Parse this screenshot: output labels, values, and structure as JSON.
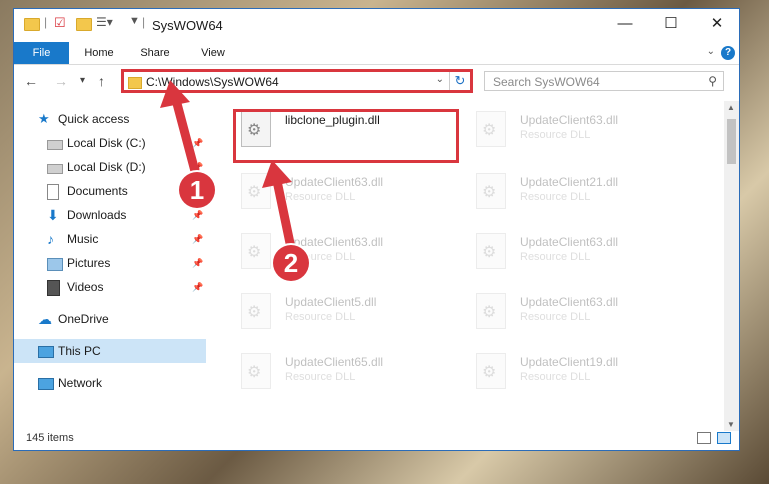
{
  "window": {
    "title": "SysWOW64",
    "minimize": "—",
    "maximize": "☐",
    "close": "✕"
  },
  "ribbon": {
    "tabs": [
      "File",
      "Home",
      "Share",
      "View"
    ],
    "help": "?"
  },
  "navigation": {
    "back": "←",
    "forward": "→",
    "recent": "▾",
    "up": "↑",
    "address": "C:\\Windows\\SysWOW64",
    "address_dropdown": "⌄",
    "refresh": "↻",
    "search_placeholder": "Search SysWOW64"
  },
  "sidebar": {
    "items": [
      {
        "label": "Quick access",
        "icon": "star-icon"
      },
      {
        "label": "Local Disk (C:)",
        "icon": "drive-icon",
        "pinned": true
      },
      {
        "label": "Local Disk (D:)",
        "icon": "drive-icon",
        "pinned": true
      },
      {
        "label": "Documents",
        "icon": "documents-icon",
        "pinned": true
      },
      {
        "label": "Downloads",
        "icon": "download-icon",
        "pinned": true
      },
      {
        "label": "Music",
        "icon": "music-icon",
        "pinned": true
      },
      {
        "label": "Pictures",
        "icon": "pictures-icon",
        "pinned": true
      },
      {
        "label": "Videos",
        "icon": "videos-icon",
        "pinned": true
      },
      {
        "label": "OneDrive",
        "icon": "cloud-icon"
      },
      {
        "label": "This PC",
        "icon": "computer-icon"
      },
      {
        "label": "Network",
        "icon": "network-icon"
      }
    ]
  },
  "files": [
    {
      "name": "libclone_plugin.dll",
      "type": ""
    },
    {
      "name": "UpdateClient63.dll",
      "type": "Resource DLL"
    },
    {
      "name": "UpdateClient63.dll",
      "type": "Resource DLL"
    },
    {
      "name": "UpdateClient21.dll",
      "type": "Resource DLL"
    },
    {
      "name": "UpdateClient63.dll",
      "type": "Resource DLL"
    },
    {
      "name": "UpdateClient63.dll",
      "type": "Resource DLL"
    },
    {
      "name": "UpdateClient5.dll",
      "type": "Resource DLL"
    },
    {
      "name": "UpdateClient63.dll",
      "type": "Resource DLL"
    },
    {
      "name": "UpdateClient65.dll",
      "type": "Resource DLL"
    },
    {
      "name": "UpdateClient19.dll",
      "type": "Resource DLL"
    }
  ],
  "status": {
    "item_count": "145 items"
  },
  "annotations": {
    "step1": "1",
    "step2": "2"
  },
  "colors": {
    "accent": "#1979ca",
    "highlight": "#d9363e"
  }
}
